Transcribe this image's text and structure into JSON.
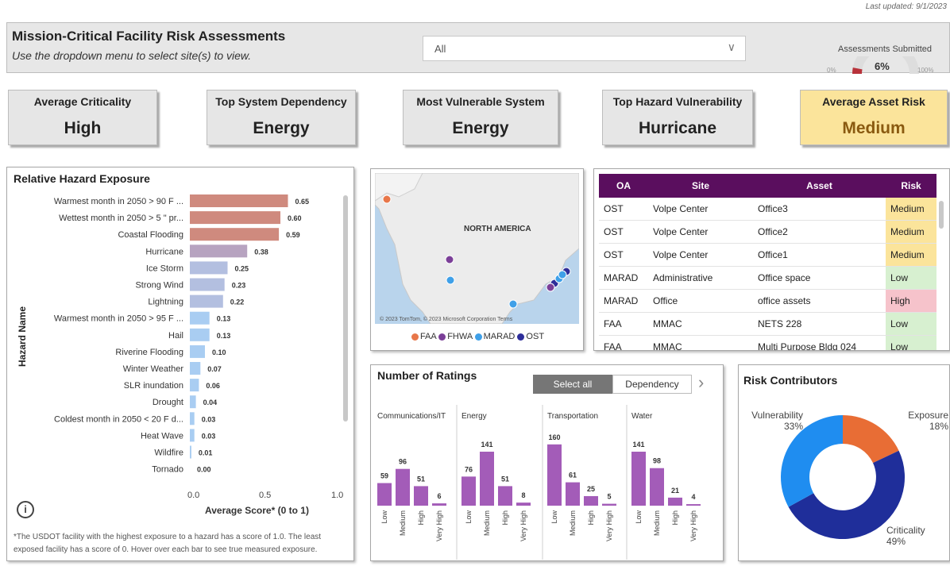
{
  "header": {
    "title": "Mission-Critical Facility Risk Assessments",
    "subtitle": "Use the dropdown menu to select site(s) to view.",
    "dropdown_value": "All",
    "last_updated": "Last updated: 9/1/2023",
    "gauge": {
      "title": "Assessments Submitted",
      "value_label": "6%",
      "min_label": "0%",
      "max_label": "100%",
      "fraction": 0.06,
      "color": "#b8323a"
    }
  },
  "kpis": [
    {
      "label": "Average Criticality",
      "value": "High"
    },
    {
      "label": "Top System Dependency",
      "value": "Energy"
    },
    {
      "label": "Most Vulnerable System",
      "value": "Energy"
    },
    {
      "label": "Top Hazard Vulnerability",
      "value": "Hurricane"
    },
    {
      "label": "Average Asset Risk",
      "value": "Medium"
    }
  ],
  "hazard": {
    "title": "Relative Hazard Exposure",
    "ylabel": "Hazard Name",
    "xlabel": "Average Score* (0 to 1)",
    "xticks": [
      "0.0",
      "0.5",
      "1.0"
    ],
    "footnote_line1": "*The USDOT facility with the highest exposure to a hazard has a score of 1.0. The least",
    "footnote_line2": "exposed facility has a score of 0. Hover over each bar to see true measured exposure.",
    "info_icon": "i"
  },
  "map": {
    "label": "NORTH AMERICA",
    "credit": "© 2023 TomTom, © 2023 Microsoft Corporation  Terms",
    "legend": [
      {
        "name": "FAA",
        "color": "#e8774a"
      },
      {
        "name": "FHWA",
        "color": "#7b3f98"
      },
      {
        "name": "MARAD",
        "color": "#3fa0e8"
      },
      {
        "name": "OST",
        "color": "#2e2e9a"
      }
    ]
  },
  "table": {
    "headers": [
      "OA",
      "Site",
      "Asset",
      "Risk"
    ],
    "rows": [
      {
        "oa": "OST",
        "site": "Volpe Center",
        "asset": "Office3",
        "risk": "Medium"
      },
      {
        "oa": "OST",
        "site": "Volpe Center",
        "asset": "Office2",
        "risk": "Medium"
      },
      {
        "oa": "OST",
        "site": "Volpe Center",
        "asset": "Office1",
        "risk": "Medium"
      },
      {
        "oa": "MARAD",
        "site": "Administrative",
        "asset": "Office space",
        "risk": "Low"
      },
      {
        "oa": "MARAD",
        "site": "Office",
        "asset": "office assets",
        "risk": "High"
      },
      {
        "oa": "FAA",
        "site": "MMAC",
        "asset": "NETS 228",
        "risk": "Low"
      },
      {
        "oa": "FAA",
        "site": "MMAC",
        "asset": "Multi Purpose Bldg 024",
        "risk": "Low"
      }
    ]
  },
  "ratings": {
    "title": "Number of Ratings",
    "select_all": "Select all",
    "dependency": "Dependency",
    "nav_arrow": "›",
    "color": "#a35cb8"
  },
  "contributors": {
    "title": "Risk Contributors",
    "labels": [
      {
        "name": "Vulnerability",
        "pct": "33%"
      },
      {
        "name": "Exposure",
        "pct": "18%"
      },
      {
        "name": "Criticality",
        "pct": "49%"
      }
    ]
  },
  "chart_data": [
    {
      "type": "bar",
      "orientation": "horizontal",
      "title": "Relative Hazard Exposure",
      "xlabel": "Average Score* (0 to 1)",
      "ylabel": "Hazard Name",
      "xlim": [
        0,
        1
      ],
      "categories": [
        "Warmest month in 2050 > 90 F ...",
        "Wettest month in 2050 > 5 \" pr...",
        "Coastal Flooding",
        "Hurricane",
        "Ice Storm",
        "Strong Wind",
        "Lightning",
        "Warmest month in 2050 > 95 F ...",
        "Hail",
        "Riverine Flooding",
        "Winter Weather",
        "SLR inundation",
        "Drought",
        "Coldest month in 2050 < 20 F d...",
        "Heat Wave",
        "Wildfire",
        "Tornado"
      ],
      "values": [
        0.65,
        0.6,
        0.59,
        0.38,
        0.25,
        0.23,
        0.22,
        0.13,
        0.13,
        0.1,
        0.07,
        0.06,
        0.04,
        0.03,
        0.03,
        0.01,
        0.0
      ],
      "value_labels": [
        "0.65",
        "0.60",
        "0.59",
        "0.38",
        "0.25",
        "0.23",
        "0.22",
        "0.13",
        "0.13",
        "0.10",
        "0.07",
        "0.06",
        "0.04",
        "0.03",
        "0.03",
        "0.01",
        "0.00"
      ],
      "colors": [
        "#cf8a7e",
        "#cf8a7e",
        "#cf8a7e",
        "#b7a3c0",
        "#b3bfe0",
        "#b3bfe0",
        "#b3bfe0",
        "#a9cdf2",
        "#a9cdf2",
        "#a9cdf2",
        "#a9cdf2",
        "#a9cdf2",
        "#a9cdf2",
        "#a9cdf2",
        "#a9cdf2",
        "#a9cdf2",
        "#a9cdf2"
      ]
    },
    {
      "type": "bar",
      "title": "Number of Ratings",
      "categories": [
        "Low",
        "Medium",
        "High",
        "Very High"
      ],
      "series": [
        {
          "name": "Communications/IT",
          "values": [
            59,
            96,
            51,
            6
          ]
        },
        {
          "name": "Energy",
          "values": [
            76,
            141,
            51,
            8
          ]
        },
        {
          "name": "Transportation",
          "values": [
            160,
            61,
            25,
            5
          ]
        },
        {
          "name": "Water",
          "values": [
            141,
            98,
            21,
            4
          ]
        }
      ],
      "ylim": [
        0,
        170
      ]
    },
    {
      "type": "pie",
      "style": "donut",
      "title": "Risk Contributors",
      "categories": [
        "Exposure",
        "Criticality",
        "Vulnerability"
      ],
      "values": [
        18,
        49,
        33
      ],
      "colors": [
        "#e86d35",
        "#1f2e9a",
        "#1f8df0"
      ]
    }
  ]
}
